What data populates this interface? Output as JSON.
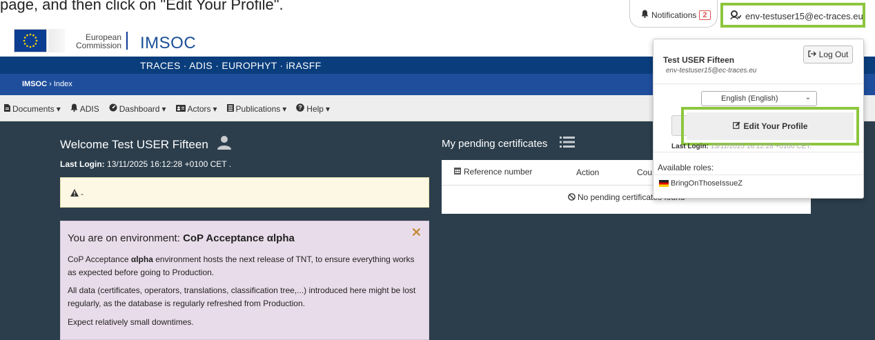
{
  "instruction": "page, and then click on \"Edit Your Profile\".",
  "header": {
    "org_line1": "European",
    "org_line2": "Commission",
    "app_title": "IMSOC",
    "notifications_label": "Notifications",
    "notifications_count": "2",
    "user_email": "env-testuser15@ec-traces.eu"
  },
  "systems_bar": "TRACES · ADIS · EUROPHYT · iRASFF",
  "breadcrumb": {
    "root": "IMSOC",
    "separator": "›",
    "current": "Index"
  },
  "menu": [
    {
      "label": "Documents",
      "icon": "document-icon",
      "caret": true
    },
    {
      "label": "ADIS",
      "icon": "bell-icon",
      "caret": false
    },
    {
      "label": "Dashboard",
      "icon": "dashboard-icon",
      "caret": true
    },
    {
      "label": "Actors",
      "icon": "id-card-icon",
      "caret": true
    },
    {
      "label": "Publications",
      "icon": "publication-icon",
      "caret": true
    },
    {
      "label": "Help",
      "icon": "question-icon",
      "caret": true
    }
  ],
  "welcome": {
    "title": "Welcome Test USER Fifteen",
    "last_login_label": "Last Login:",
    "last_login_value": "13/11/2025 16:12:28 +0100 CET ."
  },
  "warning": {
    "text": "-"
  },
  "environment": {
    "title_prefix": "You are on environment:",
    "title_env": "CoP Acceptance αlpha",
    "p1_prefix": "CoP Acceptance ",
    "p1_bold": "αlpha",
    "p1_suffix": " environment hosts the next release of TNT, to ensure everything works as expected before going to Production.",
    "p2": "All data (certificates, operators, translations, classification tree,...) introduced here might be lost regularly, as the database is regularly refreshed from Production.",
    "p3": "Expect relatively small downtimes."
  },
  "pending": {
    "title": "My pending certificates",
    "columns": [
      "Reference number",
      "Action",
      "Cou"
    ],
    "empty_text": "No pending certificates found"
  },
  "user_dropdown": {
    "name": "Test USER Fifteen",
    "email": "env-testuser15@ec-traces.eu",
    "logout_label": "Log Out",
    "language_value": "English (English)",
    "edit_profile_label": "Edit Your Profile",
    "last_login_label": "Last Login:",
    "last_login_value": "13/11/2025 16:12:28 +0100 CET.",
    "roles_label": "Available roles:",
    "role_name": "BringOnThoseIssueZ"
  },
  "colors": {
    "highlight": "#8dc63f",
    "navy": "#0a3d7c",
    "main_bg": "#2c3e4c"
  }
}
